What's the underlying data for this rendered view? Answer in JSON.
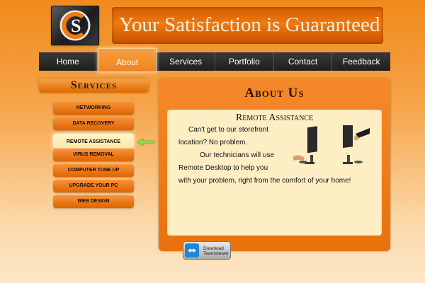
{
  "header": {
    "banner_text": "Your Satisfaction is Guaranteed",
    "logo_letters": "CS"
  },
  "nav": {
    "items": [
      "Home",
      "About",
      "Services",
      "Portfolio",
      "Contact",
      "Feedback"
    ],
    "active": "About"
  },
  "sidebar": {
    "title": "Services",
    "items": [
      "NETWORKING",
      "DATA RECOVERY",
      "REMOTE ASSISTANCE",
      "VIRUS REMOVAL",
      "COMPUTER TUNE UP",
      "UPGRADE YOUR PC",
      "WEB DESIGN"
    ],
    "active": "REMOTE ASSISTANCE"
  },
  "main": {
    "title": "About Us",
    "section_title": "Remote Assistance",
    "line1": "Can't get to our storefront",
    "line2": "location? No problem.",
    "line3": "Our technicians will use",
    "line4": "Remote Desktop to help you",
    "line5": "with your problem, right from the comfort of your home!",
    "download_button": {
      "label1": "Download",
      "label2": "TeamViewer",
      "icon": "teamviewer-icon"
    }
  },
  "colors": {
    "accent": "#f08a1c",
    "nav_bg": "#2a2a2a",
    "panel_inner": "#fdeec4"
  }
}
